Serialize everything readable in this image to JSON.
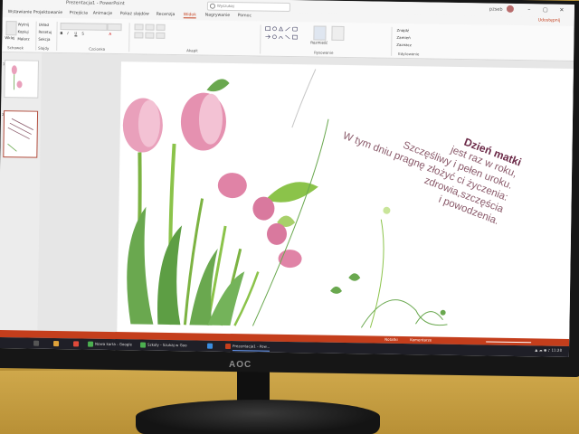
{
  "app": {
    "window_title": "Prezentacja1 - PowerPoint",
    "search_placeholder": "Wyszukaj",
    "user_name": "pzseb",
    "share_label": "Udostępnij"
  },
  "ribbon": {
    "tabs": [
      "Wstawianie",
      "Projektowanie",
      "Przejścia",
      "Animacje",
      "Pokaz slajdów",
      "Recenzja",
      "Widok",
      "Nagrywanie",
      "Pomoc"
    ],
    "active_tab_index": 6,
    "groups": [
      "Schowek",
      "Slajdy",
      "Czcionka",
      "Akapit",
      "Rysowanie",
      "Edytowanie"
    ],
    "buttons": {
      "paste": "Wklej",
      "new_slide": "Nowy slajd",
      "cut": "Wytnij",
      "copy": "Kopiuj",
      "format_painter": "Malarz",
      "layout": "Układ",
      "reset": "Resetuj",
      "section": "Sekcja",
      "arrange": "Rozmieść",
      "quick_styles": "Szybkie style",
      "find": "Znajdź",
      "replace": "Zamień",
      "select": "Zaznacz"
    }
  },
  "slide": {
    "poem_lines": [
      "Dzień matki",
      "jest raz w roku,",
      "Szczęśliwy i pełen uroku.",
      "W tym dniu pragnę złożyć ci życzenia:",
      "zdrowia,szczęścia",
      "i powodzenia."
    ]
  },
  "thumbnails": [
    {
      "number": "1"
    },
    {
      "number": "2"
    }
  ],
  "statusbar": {
    "notes_label": "Notatki",
    "comments_label": "Komentarze"
  },
  "taskbar": {
    "items": [
      "Nowa karta - Google",
      "Szkoły - Szukaj w Goo",
      "Prezentacja1 - Pow..."
    ],
    "active_index": 2
  },
  "brand": {
    "logo_text": "AOC"
  },
  "colors": {
    "accent": "#c43e1c",
    "poem_title": "#6b2947",
    "poem_text": "#8a5a6a",
    "tulip_pink": "#e9a0bb",
    "leaf_green": "#6aa84f"
  }
}
